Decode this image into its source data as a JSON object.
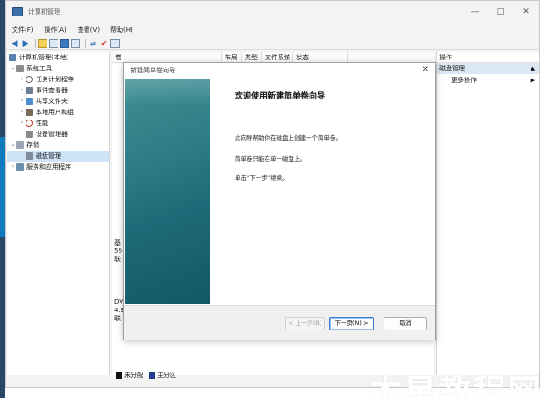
{
  "window": {
    "title": "计算机管理",
    "controls": {
      "minimize": "—",
      "maximize": "□",
      "close": "✕"
    }
  },
  "menubar": {
    "items": [
      "文件(F)",
      "操作(A)",
      "查看(V)",
      "帮助(H)"
    ]
  },
  "tree": {
    "root": "计算机管理(本地)",
    "system_tools": "系统工具",
    "task_scheduler": "任务计划程序",
    "event_viewer": "事件查看器",
    "shared_folders": "共享文件夹",
    "local_users": "本地用户和组",
    "performance": "性能",
    "device_manager": "设备管理器",
    "storage": "存储",
    "disk_management": "磁盘管理",
    "services_apps": "服务和应用程序"
  },
  "center": {
    "columns": [
      "卷",
      "布局",
      "类型",
      "文件系统",
      "状态"
    ],
    "disk_labels": [
      {
        "line1": "基",
        "line2": "59",
        "line3": "联"
      },
      {
        "line1": "DV",
        "line2": "4.3",
        "line3": "联"
      }
    ],
    "legend": {
      "unallocated": "未分配",
      "primary": "主分区"
    }
  },
  "actions": {
    "header": "操作",
    "section": "磁盘管理",
    "more": "更多操作"
  },
  "dialog": {
    "title": "新建简单卷向导",
    "heading": "欢迎使用新建简单卷向导",
    "para1": "此向导帮助你在磁盘上创建一个简单卷。",
    "para2": "简单卷只能在单一磁盘上。",
    "para3": "单击“下一步”继续。",
    "back_button": "< 上一步(B)",
    "next_button": "下一页(N) >",
    "cancel_button": "取消"
  },
  "watermark": "木星教程网",
  "colors": {
    "accent": "#3b7bd4",
    "selection": "#cfe3f7",
    "wizard_banner": "#1f6a78",
    "primary_partition": "#1d3c8a"
  }
}
